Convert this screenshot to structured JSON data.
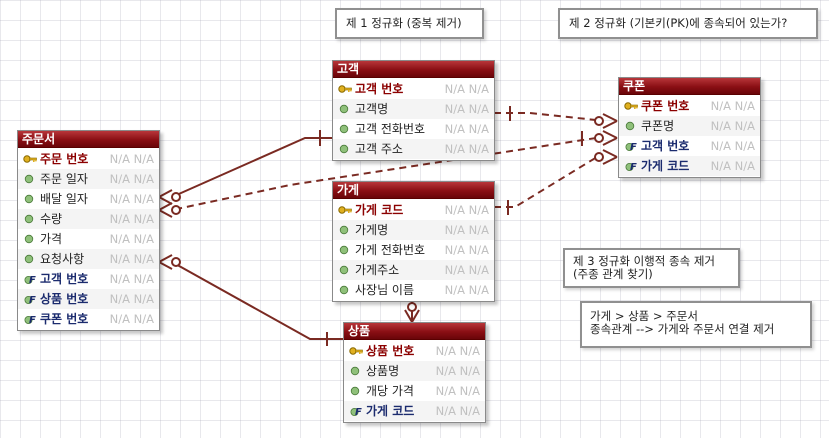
{
  "notes": {
    "nf1": "제 1 정규화 (중복 제거)",
    "nf2": "제 2 정규화 (기본키(PK)에 종속되어 있는가?",
    "nf3": [
      "제 3 정규화 이행적 종속 제거",
      "(주종 관계 찾기)"
    ],
    "dep": [
      "가게 > 상품 > 주문서",
      "종속관계 --> 가게와 주문서 연결 제거"
    ]
  },
  "entities": {
    "order": {
      "title": "주문서",
      "rows": [
        {
          "label": "주문 번호",
          "kind": "pk",
          "type": "N/A N/A"
        },
        {
          "label": "주문 일자",
          "kind": "attr",
          "type": "N/A N/A"
        },
        {
          "label": "배달 일자",
          "kind": "attr",
          "type": "N/A N/A"
        },
        {
          "label": "수량",
          "kind": "attr",
          "type": "N/A N/A"
        },
        {
          "label": "가격",
          "kind": "attr",
          "type": "N/A N/A"
        },
        {
          "label": "요청사항",
          "kind": "attr",
          "type": "N/A N/A"
        },
        {
          "label": "고객 번호",
          "kind": "fk",
          "type": "N/A N/A"
        },
        {
          "label": "상품 번호",
          "kind": "fk",
          "type": "N/A N/A"
        },
        {
          "label": "쿠폰 번호",
          "kind": "fk",
          "type": "N/A N/A"
        }
      ]
    },
    "customer": {
      "title": "고객",
      "rows": [
        {
          "label": "고객 번호",
          "kind": "pk",
          "type": "N/A N/A"
        },
        {
          "label": "고객명",
          "kind": "attr",
          "type": "N/A N/A"
        },
        {
          "label": "고객 전화번호",
          "kind": "attr",
          "type": "N/A N/A"
        },
        {
          "label": "고객 주소",
          "kind": "attr",
          "type": "N/A N/A"
        }
      ]
    },
    "store": {
      "title": "가게",
      "rows": [
        {
          "label": "가게 코드",
          "kind": "pk",
          "type": "N/A N/A"
        },
        {
          "label": "가게명",
          "kind": "attr",
          "type": "N/A N/A"
        },
        {
          "label": "가게 전화번호",
          "kind": "attr",
          "type": "N/A N/A"
        },
        {
          "label": "가게주소",
          "kind": "attr",
          "type": "N/A N/A"
        },
        {
          "label": "사장님 이름",
          "kind": "attr",
          "type": "N/A N/A"
        }
      ]
    },
    "coupon": {
      "title": "쿠폰",
      "rows": [
        {
          "label": "쿠폰 번호",
          "kind": "pk",
          "type": "N/A N/A"
        },
        {
          "label": "쿠폰명",
          "kind": "attr",
          "type": "N/A N/A"
        },
        {
          "label": "고객 번호",
          "kind": "fk",
          "type": "N/A N/A"
        },
        {
          "label": "가게 코드",
          "kind": "fk",
          "type": "N/A N/A"
        }
      ]
    },
    "product": {
      "title": "상품",
      "rows": [
        {
          "label": "상품 번호",
          "kind": "pk",
          "type": "N/A N/A"
        },
        {
          "label": "상품명",
          "kind": "attr",
          "type": "N/A N/A"
        },
        {
          "label": "개당 가격",
          "kind": "attr",
          "type": "N/A N/A"
        },
        {
          "label": "가게 코드",
          "kind": "fk",
          "type": "N/A N/A"
        }
      ]
    }
  },
  "relationships": [
    {
      "from": "customer",
      "to": "order",
      "style": "solid"
    },
    {
      "from": "customer",
      "to": "coupon",
      "style": "dashed"
    },
    {
      "from": "store",
      "to": "coupon",
      "style": "dashed"
    },
    {
      "from": "coupon",
      "to": "order",
      "style": "dashed"
    },
    {
      "from": "product",
      "to": "order",
      "style": "solid"
    },
    {
      "from": "store",
      "to": "product",
      "style": "solid"
    }
  ],
  "colors": {
    "header": "#8a0f14",
    "line": "#7a2a22",
    "pk_text": "#8b0000",
    "fk_text": "#1b2b6e",
    "type_text": "#c0c0c0"
  }
}
